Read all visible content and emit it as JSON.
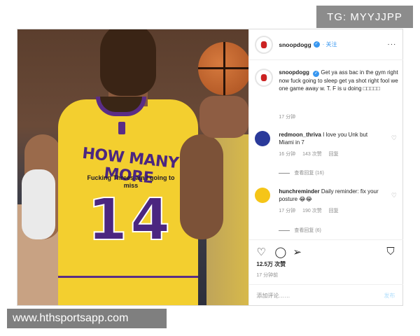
{
  "tg_badge": "TG: MYYJJPP",
  "watermark": "www.hthsportsapp.com",
  "photo": {
    "jersey_name": "HOW MANY MORE",
    "jersey_subtext": "Fucking Threes am i going to miss",
    "jersey_number": "14"
  },
  "header": {
    "username": "snoopdogg",
    "verified_glyph": "✓",
    "follow": "关注",
    "more": "···"
  },
  "caption": {
    "username": "snoopdogg",
    "text": "Get ya ass bac in the gym right now fuck going to sleep get ya shot right fool we one game away w. T. F is u doing □□□□□",
    "time": "17 分钟"
  },
  "comments": [
    {
      "username": "redmoon_thriva",
      "text": "I love you Unk but Miami in 7",
      "time": "16 分钟",
      "likes": "143 次赞",
      "reply": "回复",
      "view_replies": "查看回复 (16)",
      "avatar_color": "#2a3a9a"
    },
    {
      "username": "hunchreminder",
      "text": "Daily reminder: fix your posture 😂😂",
      "time": "17 分钟",
      "likes": "190 次赞",
      "reply": "回复",
      "view_replies": "查看回复 (6)",
      "avatar_color": "#f5c518"
    }
  ],
  "actions": {
    "like_icon": "heart-icon",
    "comment_icon": "comment-icon",
    "share_icon": "share-icon",
    "save_icon": "bookmark-icon"
  },
  "likes_count": "12.5万 次赞",
  "posted_ago": "17 分钟前",
  "add_comment": {
    "placeholder": "添加评论……",
    "post_label": "发布"
  },
  "colors": {
    "accent": "#3897f0",
    "jersey_yellow": "#f3cf2f",
    "jersey_purple": "#4b2680"
  }
}
